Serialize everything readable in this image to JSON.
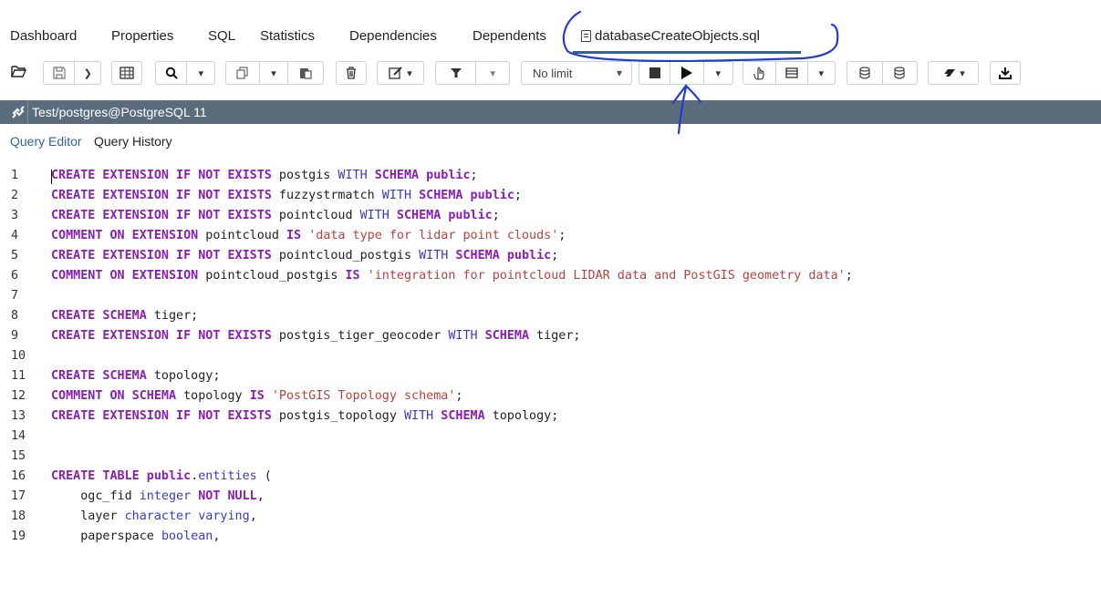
{
  "tabs": [
    {
      "label": "Dashboard"
    },
    {
      "label": "Properties"
    },
    {
      "label": "SQL"
    },
    {
      "label": "Statistics"
    },
    {
      "label": "Dependencies"
    },
    {
      "label": "Dependents"
    },
    {
      "label": "databaseCreateObjects.sql",
      "icon": "file-icon",
      "active": true
    }
  ],
  "toolbar": {
    "limit_value": "No limit",
    "icons": [
      "open-file-icon",
      "save-icon",
      "chevron-down-icon",
      "grid-icon",
      "search-icon",
      "chevron-down-icon",
      "copy-icon",
      "chevron-down-icon",
      "paste-icon",
      "delete-icon",
      "edit-icon",
      "chevron-down-icon",
      "filter-icon",
      "chevron-down-icon",
      "stop-icon",
      "execute-icon",
      "chevron-down-icon",
      "explain-icon",
      "explain-analyze-icon",
      "chevron-down-icon",
      "commit-icon",
      "rollback-icon",
      "clear-icon",
      "chevron-down-icon",
      "download-icon"
    ]
  },
  "connection": {
    "label": "Test/postgres@PostgreSQL 11"
  },
  "subtabs": [
    {
      "label": "Query Editor",
      "active": true
    },
    {
      "label": "Query History"
    }
  ],
  "editor": {
    "lines": [
      {
        "n": "1",
        "segs": [
          [
            "kw",
            "CREATE EXTENSION IF NOT EXISTS"
          ],
          [
            "plain",
            " postgis "
          ],
          [
            "kwp",
            "WITH"
          ],
          [
            "plain",
            " "
          ],
          [
            "kw",
            "SCHEMA public"
          ],
          [
            "plain",
            ";"
          ]
        ]
      },
      {
        "n": "2",
        "segs": [
          [
            "kw",
            "CREATE EXTENSION IF NOT EXISTS"
          ],
          [
            "plain",
            " fuzzystrmatch "
          ],
          [
            "kwp",
            "WITH"
          ],
          [
            "plain",
            " "
          ],
          [
            "kw",
            "SCHEMA public"
          ],
          [
            "plain",
            ";"
          ]
        ]
      },
      {
        "n": "3",
        "segs": [
          [
            "kw",
            "CREATE EXTENSION IF NOT EXISTS"
          ],
          [
            "plain",
            " pointcloud "
          ],
          [
            "kwp",
            "WITH"
          ],
          [
            "plain",
            " "
          ],
          [
            "kw",
            "SCHEMA public"
          ],
          [
            "plain",
            ";"
          ]
        ]
      },
      {
        "n": "4",
        "segs": [
          [
            "kw",
            "COMMENT ON EXTENSION"
          ],
          [
            "plain",
            " pointcloud "
          ],
          [
            "kw",
            "IS"
          ],
          [
            "plain",
            " "
          ],
          [
            "str",
            "'data type for lidar point clouds'"
          ],
          [
            "plain",
            ";"
          ]
        ]
      },
      {
        "n": "5",
        "segs": [
          [
            "kw",
            "CREATE EXTENSION IF NOT EXISTS"
          ],
          [
            "plain",
            " pointcloud_postgis "
          ],
          [
            "kwp",
            "WITH"
          ],
          [
            "plain",
            " "
          ],
          [
            "kw",
            "SCHEMA public"
          ],
          [
            "plain",
            ";"
          ]
        ]
      },
      {
        "n": "6",
        "segs": [
          [
            "kw",
            "COMMENT ON EXTENSION"
          ],
          [
            "plain",
            " pointcloud_postgis "
          ],
          [
            "kw",
            "IS"
          ],
          [
            "plain",
            " "
          ],
          [
            "str",
            "'integration for pointcloud LIDAR data and PostGIS geometry data'"
          ],
          [
            "plain",
            ";"
          ]
        ]
      },
      {
        "n": "7",
        "segs": []
      },
      {
        "n": "8",
        "segs": [
          [
            "kw",
            "CREATE SCHEMA"
          ],
          [
            "plain",
            " tiger;"
          ]
        ]
      },
      {
        "n": "9",
        "segs": [
          [
            "kw",
            "CREATE EXTENSION IF NOT EXISTS"
          ],
          [
            "plain",
            " postgis_tiger_geocoder "
          ],
          [
            "kwp",
            "WITH"
          ],
          [
            "plain",
            " "
          ],
          [
            "kw",
            "SCHEMA"
          ],
          [
            "plain",
            " tiger;"
          ]
        ]
      },
      {
        "n": "10",
        "segs": []
      },
      {
        "n": "11",
        "segs": [
          [
            "kw",
            "CREATE SCHEMA"
          ],
          [
            "plain",
            " topology;"
          ]
        ]
      },
      {
        "n": "12",
        "segs": [
          [
            "kw",
            "COMMENT ON SCHEMA"
          ],
          [
            "plain",
            " topology "
          ],
          [
            "kw",
            "IS"
          ],
          [
            "plain",
            " "
          ],
          [
            "str",
            "'PostGIS Topology schema'"
          ],
          [
            "plain",
            ";"
          ]
        ]
      },
      {
        "n": "13",
        "segs": [
          [
            "kw",
            "CREATE EXTENSION IF NOT EXISTS"
          ],
          [
            "plain",
            " postgis_topology "
          ],
          [
            "kwp",
            "WITH"
          ],
          [
            "plain",
            " "
          ],
          [
            "kw",
            "SCHEMA"
          ],
          [
            "plain",
            " topology;"
          ]
        ]
      },
      {
        "n": "14",
        "segs": []
      },
      {
        "n": "15",
        "segs": []
      },
      {
        "n": "16",
        "segs": [
          [
            "kw",
            "CREATE TABLE public"
          ],
          [
            "plain",
            "."
          ],
          [
            "kwp",
            "entities"
          ],
          [
            "plain",
            " ("
          ]
        ]
      },
      {
        "n": "17",
        "segs": [
          [
            "plain",
            "    ogc_fid "
          ],
          [
            "kwp",
            "integer"
          ],
          [
            "plain",
            " "
          ],
          [
            "kw",
            "NOT NULL"
          ],
          [
            "plain",
            ","
          ]
        ]
      },
      {
        "n": "18",
        "segs": [
          [
            "plain",
            "    layer "
          ],
          [
            "kwp",
            "character varying"
          ],
          [
            "plain",
            ","
          ]
        ]
      },
      {
        "n": "19",
        "segs": [
          [
            "plain",
            "    paperspace "
          ],
          [
            "kwp",
            "boolean"
          ],
          [
            "plain",
            ","
          ]
        ]
      }
    ]
  },
  "colors": {
    "keyword": "#8a1db2",
    "keyword_secondary": "#3c3cba",
    "string": "#b8423d",
    "connection_bar": "#5b6d7c",
    "accent": "#326690",
    "annotation_ink": "#1e3fd0"
  }
}
